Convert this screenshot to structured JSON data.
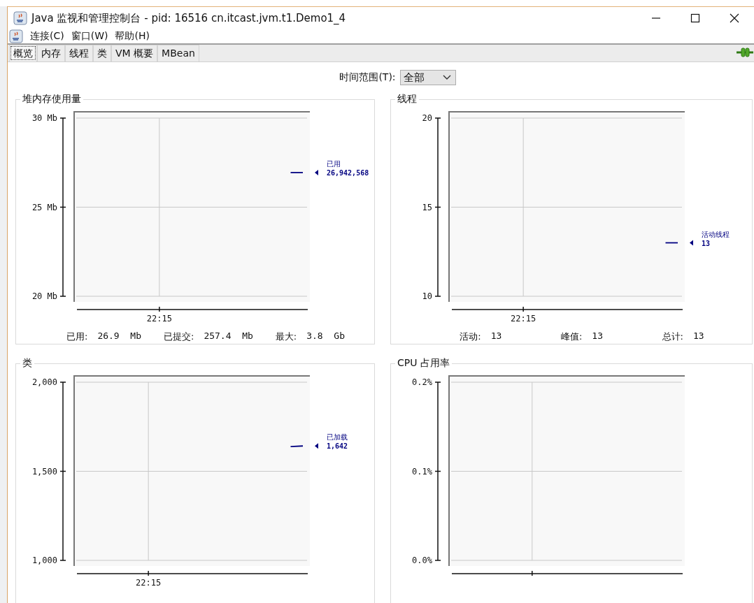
{
  "window": {
    "title": "Java 监视和管理控制台 - pid: 16516 cn.itcast.jvm.t1.Demo1_4"
  },
  "menu": [
    "连接(C)",
    "窗口(W)",
    "帮助(H)"
  ],
  "tabs": [
    {
      "label": "概览",
      "selected": true
    },
    {
      "label": "内存",
      "selected": false
    },
    {
      "label": "线程",
      "selected": false
    },
    {
      "label": "类",
      "selected": false
    },
    {
      "label": "VM 概要",
      "selected": false
    },
    {
      "label": "MBean",
      "selected": false
    }
  ],
  "time_range": {
    "label": "时间范围(T):",
    "value": "全部"
  },
  "panels": [
    {
      "title": "堆内存使用量",
      "chart_data": {
        "type": "line",
        "ylim": [
          20,
          30
        ],
        "yticks": [
          {
            "value": 30,
            "label": "30 Mb"
          },
          {
            "value": 25,
            "label": "25 Mb"
          },
          {
            "value": 20,
            "label": "20 Mb"
          }
        ],
        "categories": [
          null,
          null,
          null,
          null,
          null,
          null,
          null,
          "22:15",
          null,
          null,
          null,
          null,
          null,
          null,
          null,
          null,
          null,
          null,
          null,
          null,
          null
        ],
        "series": [
          {
            "name": "已用",
            "color": "#000080",
            "values": [
              null,
              null,
              null,
              null,
              null,
              null,
              null,
              null,
              null,
              null,
              null,
              null,
              null,
              null,
              null,
              null,
              null,
              null,
              null,
              26.94,
              26.94
            ]
          }
        ]
      },
      "legend_value": "26,942,568",
      "stats": [
        {
          "label": "已用:",
          "value": "26.9  Mb"
        },
        {
          "label": "已提交:",
          "value": "257.4  Mb"
        },
        {
          "label": "最大:",
          "value": "3.8  Gb"
        }
      ]
    },
    {
      "title": "线程",
      "chart_data": {
        "type": "line",
        "ylim": [
          10,
          20
        ],
        "yticks": [
          {
            "value": 20,
            "label": "20"
          },
          {
            "value": 15,
            "label": "15"
          },
          {
            "value": 10,
            "label": "10"
          }
        ],
        "categories": [
          null,
          null,
          null,
          null,
          null,
          null,
          "22:15",
          null,
          null,
          null,
          null,
          null,
          null,
          null,
          null,
          null,
          null,
          null,
          null,
          null,
          null
        ],
        "series": [
          {
            "name": "活动线程",
            "color": "#000080",
            "values": [
              null,
              null,
              null,
              null,
              null,
              null,
              null,
              null,
              null,
              null,
              null,
              null,
              null,
              null,
              null,
              null,
              null,
              null,
              null,
              13,
              13
            ]
          }
        ]
      },
      "legend_value": "13",
      "stats": [
        {
          "label": "活动:",
          "value": "13"
        },
        {
          "label": "峰值:",
          "value": "13"
        },
        {
          "label": "总计:",
          "value": "13"
        }
      ]
    },
    {
      "title": "类",
      "chart_data": {
        "type": "line",
        "ylim": [
          1000,
          2000
        ],
        "yticks": [
          {
            "value": 2000,
            "label": "2,000"
          },
          {
            "value": 1500,
            "label": "1,500"
          },
          {
            "value": 1000,
            "label": "1,000"
          }
        ],
        "categories": [
          null,
          null,
          null,
          null,
          null,
          null,
          "22:15",
          null,
          null,
          null,
          null,
          null,
          null,
          null,
          null,
          null,
          null,
          null,
          null,
          null,
          null
        ],
        "series": [
          {
            "name": "已加载",
            "color": "#000080",
            "values": [
              null,
              null,
              null,
              null,
              null,
              null,
              null,
              null,
              null,
              null,
              null,
              null,
              null,
              null,
              null,
              null,
              null,
              null,
              null,
              1639,
              1642
            ]
          }
        ]
      },
      "legend_value": "1,642"
    },
    {
      "title": "CPU 占用率",
      "chart_data": {
        "type": "line",
        "ylim": [
          0,
          0.2
        ],
        "yticks": [
          {
            "value": 0.2,
            "label": "0.2%"
          },
          {
            "value": 0.1,
            "label": "0.1%"
          },
          {
            "value": 0,
            "label": "0.0%"
          }
        ],
        "categories": [
          null,
          null,
          null,
          null,
          null,
          null,
          null,
          null,
          null,
          null,
          null,
          null,
          null,
          null,
          null,
          null,
          null,
          null,
          null,
          null,
          null
        ]
      }
    }
  ]
}
